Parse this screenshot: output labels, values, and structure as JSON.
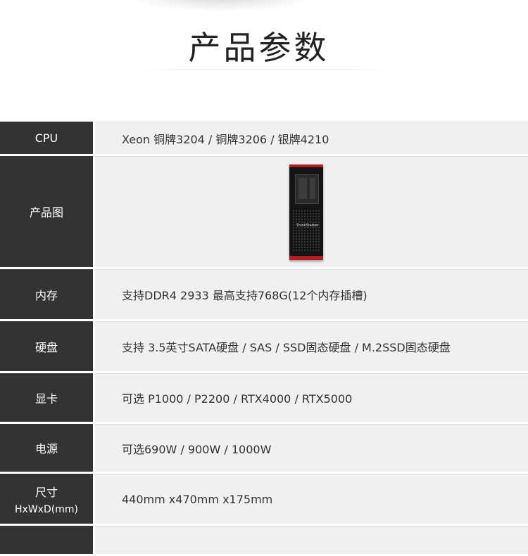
{
  "page": {
    "title": "产品参数"
  },
  "specs": [
    {
      "label": "CPU",
      "value": "Xeon 铜牌3204 / 铜牌3206 / 银牌4210"
    },
    {
      "label": "产品图",
      "image_icon": "workstation-tower-icon",
      "image_badge": "ThinkStation"
    },
    {
      "label": "内存",
      "value": "支持DDR4 2933 最高支持768G(12个内存插槽)"
    },
    {
      "label": "硬盘",
      "value": "支持 3.5英寸SATA硬盘 / SAS / SSD固态硬盘 / M.2SSD固态硬盘"
    },
    {
      "label": "显卡",
      "value": "可选 P1000 / P2200 / RTX4000 / RTX5000"
    },
    {
      "label": "电源",
      "value": "可选690W / 900W / 1000W"
    },
    {
      "label": "尺寸",
      "sublabel": "HxWxD(mm)",
      "value": "440mm x470mm x175mm"
    }
  ],
  "colors": {
    "label_bg": "#333333",
    "value_bg": "#f0f0f0",
    "accent_red": "#b21e23"
  }
}
